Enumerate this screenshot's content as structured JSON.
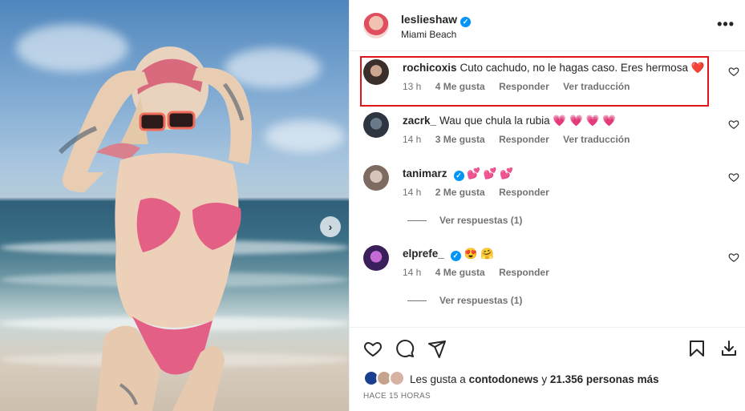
{
  "post": {
    "username": "leslieshaw",
    "location": "Miami Beach",
    "more_icon": "more-options-icon",
    "next_icon": "chevron-right-icon"
  },
  "comments": [
    {
      "username": "rochicoxis",
      "text": "Cuto cachudo, no le hagas caso. Eres hermosa",
      "emoji": "❤️",
      "time": "13 h",
      "likes": "4 Me gusta",
      "reply": "Responder",
      "translate": "Ver traducción"
    },
    {
      "username": "zacrk_",
      "text": "Wau que chula la rubia",
      "emoji": "💗 💗 💗 💗",
      "time": "14 h",
      "likes": "3 Me gusta",
      "reply": "Responder",
      "translate": "Ver traducción"
    },
    {
      "username": "tanimarz",
      "text": "",
      "emoji": "💕 💕 💕",
      "time": "14 h",
      "likes": "2 Me gusta",
      "reply": "Responder",
      "view_replies": "Ver respuestas (1)"
    },
    {
      "username": "elprefe_",
      "text": "",
      "emoji": "😍 🤗",
      "time": "14 h",
      "likes": "4 Me gusta",
      "reply": "Responder",
      "view_replies": "Ver respuestas (1)"
    }
  ],
  "likes_line": {
    "prefix": "Les gusta a ",
    "user": "contodonews",
    "middle": " y ",
    "count": "21.356 personas más"
  },
  "time_ago": "HACE 15 HORAS",
  "colors": {
    "highlight": "#e0151a",
    "verified": "#0095f6",
    "secondary_text": "#737373"
  }
}
